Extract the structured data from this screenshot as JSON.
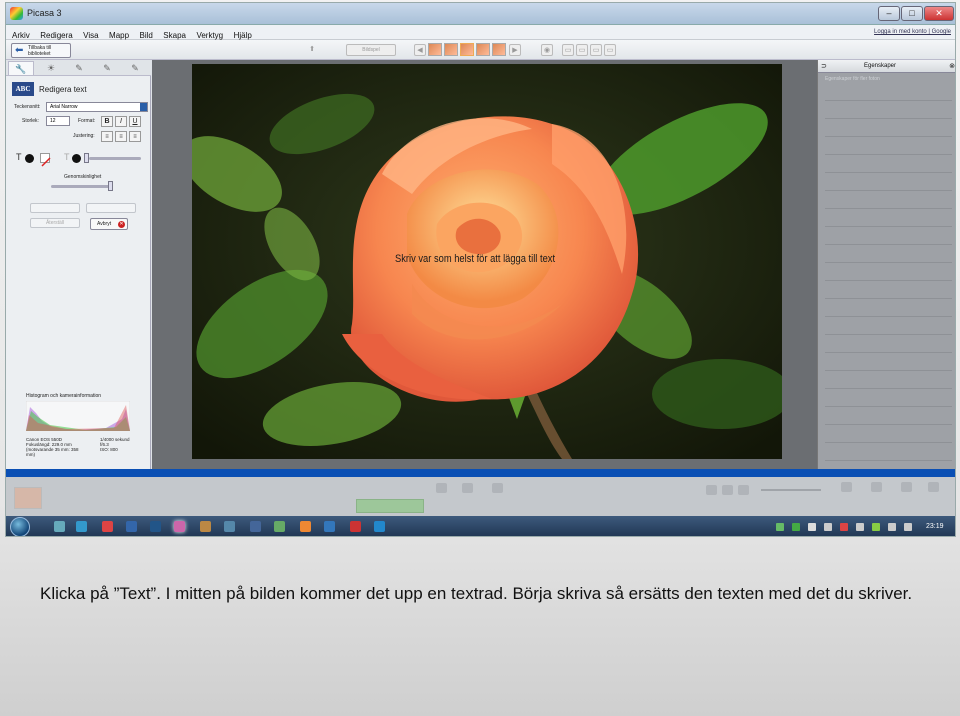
{
  "window": {
    "title": "Picasa 3"
  },
  "menu": [
    "Arkiv",
    "Redigera",
    "Visa",
    "Mapp",
    "Bild",
    "Skapa",
    "Verktyg",
    "Hjälp"
  ],
  "google_link": "Logga in med konto | Google",
  "toolbar": {
    "back_label": "Tillbaka till biblioteket",
    "slideshow_label": "Bildspel"
  },
  "left_panel": {
    "title": "Redigera text",
    "font_label": "Teckensnitt:",
    "font_value": "Arial Narrow",
    "size_label": "Storlek:",
    "size_value": "12",
    "format_label": "Format:",
    "bold": "B",
    "italic": "I",
    "underline": "U",
    "align_label": "Justering:",
    "color_t": "T",
    "transparency_label": "Genomskinlighet",
    "reset_label": "Återställ",
    "cancel_label": "Avbryt",
    "histogram_title": "Histogram och kamerainformation",
    "camera": [
      "Canon EOS 550D",
      "Fokuslängd: 229.0 mm",
      "(motsvarande 35 mm: 358 mm)"
    ],
    "exposure": [
      "1/4000 sekund",
      "f/6.3",
      "ISO: 800"
    ]
  },
  "photo": {
    "overlay_text": "Skriv var som helst för att lägga till text"
  },
  "right_panel": {
    "title": "Egenskaper",
    "subtitle": "Egenskaper för fler foton"
  },
  "taskbar": {
    "clock": "23:19"
  },
  "caption": "Klicka på ”Text”. I mitten på bilden kommer det upp en textrad. Börja skriva så ersätts den texten med det du skriver."
}
